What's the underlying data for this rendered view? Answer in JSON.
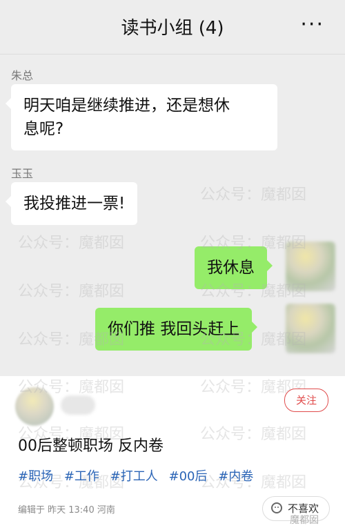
{
  "header": {
    "title": "读书小组 (4)",
    "more_icon": "more-icon"
  },
  "messages": [
    {
      "sender": "朱总",
      "text": "明天咱是继续推进，还是想休\n息呢?"
    },
    {
      "sender": "玉玉",
      "text": "我投推进一票!"
    },
    {
      "text": "我休息"
    },
    {
      "text": "你们推 我回头赶上"
    }
  ],
  "watermarks": {
    "text": "公众号：魔都囡"
  },
  "card": {
    "follow_label": "关注",
    "title": "00后整顿职场 反内卷",
    "tags": [
      "#职场",
      "#工作",
      "#打工人",
      "#00后",
      "#内卷"
    ],
    "meta": "编辑于 昨天 13:40 河南",
    "dislike_label": "不喜欢",
    "brand": "魔都囡"
  },
  "colors": {
    "chat_bg": "#ededed",
    "bubble_green": "#95ec69",
    "tag_blue": "#2a64b6",
    "follow_red": "#e04b4b"
  }
}
